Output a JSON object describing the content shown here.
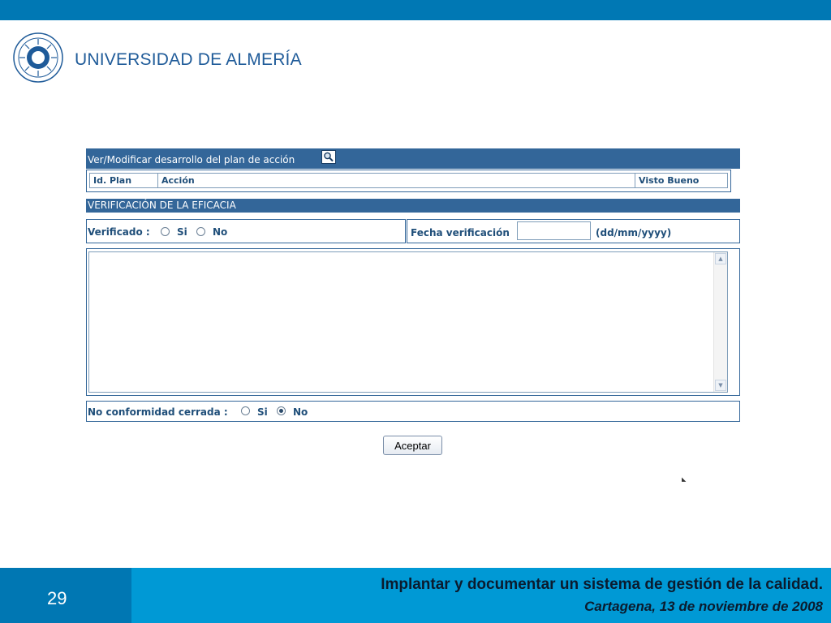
{
  "header": {
    "university_name": "UNIVERSIDAD DE ALMERÍA",
    "logo_icon": "university-seal-icon"
  },
  "plan_section": {
    "title": "Ver/Modificar desarrollo del plan de acción",
    "search_icon": "magnifier-icon",
    "columns": [
      "Id. Plan",
      "Acción",
      "Visto Bueno"
    ]
  },
  "verification": {
    "title": "VERIFICACIÓN DE LA EFICACIA",
    "verificado_label": "Verificado :",
    "option_si": "Si",
    "option_no": "No",
    "verificado_selected": null,
    "fecha_label": "Fecha verificación",
    "fecha_value": "",
    "fecha_format": "(dd/mm/yyyy)",
    "notes_value": ""
  },
  "no_conformidad": {
    "label": "No conformidad cerrada :",
    "option_si": "Si",
    "option_no": "No",
    "selected": "No"
  },
  "actions": {
    "accept_label": "Aceptar"
  },
  "footer": {
    "page_number": "29",
    "title": "Implantar y documentar un sistema de gestión de la calidad.",
    "subtitle": "Cartagena, 13 de noviembre de 2008"
  },
  "colors": {
    "top_bar": "#0078b4",
    "section_header": "#336699",
    "footer_left": "#0077b3",
    "footer_right": "#0099d5"
  }
}
